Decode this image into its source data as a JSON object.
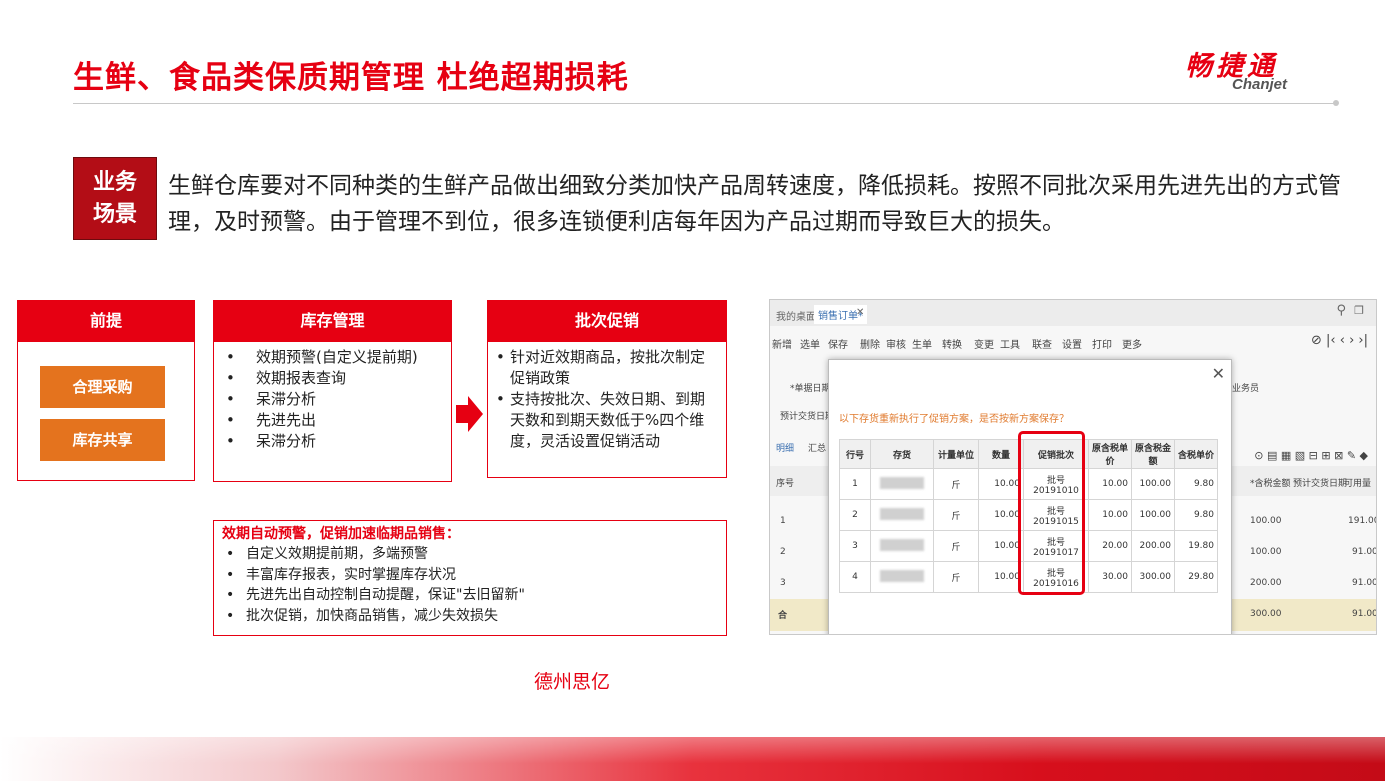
{
  "header": {
    "title": "生鲜、食品类保质期管理 杜绝超期损耗",
    "logo_cn": "畅捷通",
    "logo_en": "Chanjet"
  },
  "scenario": {
    "label_line1": "业务",
    "label_line2": "场景",
    "text": "生鲜仓库要对不同种类的生鲜产品做出细致分类加快产品周转速度，降低损耗。按照不同批次采用先进先出的方式管理，及时预警。由于管理不到位，很多连锁便利店每年因为产品过期而导致巨大的损失。"
  },
  "columns": {
    "premise": {
      "title": "前提",
      "items": [
        "合理采购",
        "库存共享"
      ]
    },
    "inventory": {
      "title": "库存管理",
      "items": [
        "效期预警(自定义提前期)",
        "效期报表查询",
        "呆滞分析",
        "先进先出",
        "呆滞分析"
      ]
    },
    "promotion": {
      "title": "批次促销",
      "items": [
        "针对近效期商品，按批次制定促销政策",
        "支持按批次、失效日期、到期天数和到期天数低于%四个维度，灵活设置促销活动"
      ]
    }
  },
  "warning_box": {
    "title": "效期自动预警，促销加速临期品销售：",
    "items": [
      "自定义效期提前期，多端预警",
      "丰富库存报表，实时掌握库存状况",
      "先进先出自动控制自动提醒，保证\"去旧留新\"",
      "批次促销，加快商品销售，减少失效损失"
    ]
  },
  "footer_name": "德州思亿",
  "screenshot": {
    "tabs": [
      "我的桌面",
      "销售订单*"
    ],
    "toolbar": [
      "新增",
      "选单",
      "保存",
      "删除",
      "审核",
      "生单",
      "转换",
      "变更",
      "工具",
      "联查",
      "设置",
      "打印",
      "更多"
    ],
    "bg_labels": {
      "doc_date": "*单据日期",
      "ship_date": "预计交货日期",
      "tab_detail": "明细",
      "tab_summary": "汇总",
      "row_no": "序号",
      "salesman": "业务员",
      "tax_amount": "*含税金额",
      "exp_ship_date": "预计交货日期",
      "avail_qty": "可用量"
    },
    "bg_rows": [
      {
        "idx": "1",
        "amount": "100.00",
        "qty": "191.00"
      },
      {
        "idx": "2",
        "amount": "100.00",
        "qty": "91.00"
      },
      {
        "idx": "3",
        "amount": "200.00",
        "qty": "91.00"
      },
      {
        "idx": "合",
        "amount": "300.00",
        "qty": "91.00"
      }
    ],
    "dialog": {
      "message": "以下存货重新执行了促销方案，是否按新方案保存？",
      "columns": [
        "行号",
        "存货",
        "计量单位",
        "数量",
        "促销批次",
        "原含税单价",
        "原含税金额",
        "含税单价"
      ],
      "rows": [
        {
          "line": "1",
          "unit": "斤",
          "qty": "10.00",
          "batch": "批号20191010",
          "orig_price": "10.00",
          "orig_amount": "100.00",
          "price": "9.80"
        },
        {
          "line": "2",
          "unit": "斤",
          "qty": "10.00",
          "batch": "批号20191015",
          "orig_price": "10.00",
          "orig_amount": "100.00",
          "price": "9.80"
        },
        {
          "line": "3",
          "unit": "斤",
          "qty": "10.00",
          "batch": "批号20191017",
          "orig_price": "20.00",
          "orig_amount": "200.00",
          "price": "19.80"
        },
        {
          "line": "4",
          "unit": "斤",
          "qty": "10.00",
          "batch": "批号20191016",
          "orig_price": "30.00",
          "orig_amount": "300.00",
          "price": "29.80"
        }
      ]
    }
  },
  "colors": {
    "brand_red": "#e60012",
    "dark_red": "#b30d16",
    "orange": "#e4731e"
  }
}
